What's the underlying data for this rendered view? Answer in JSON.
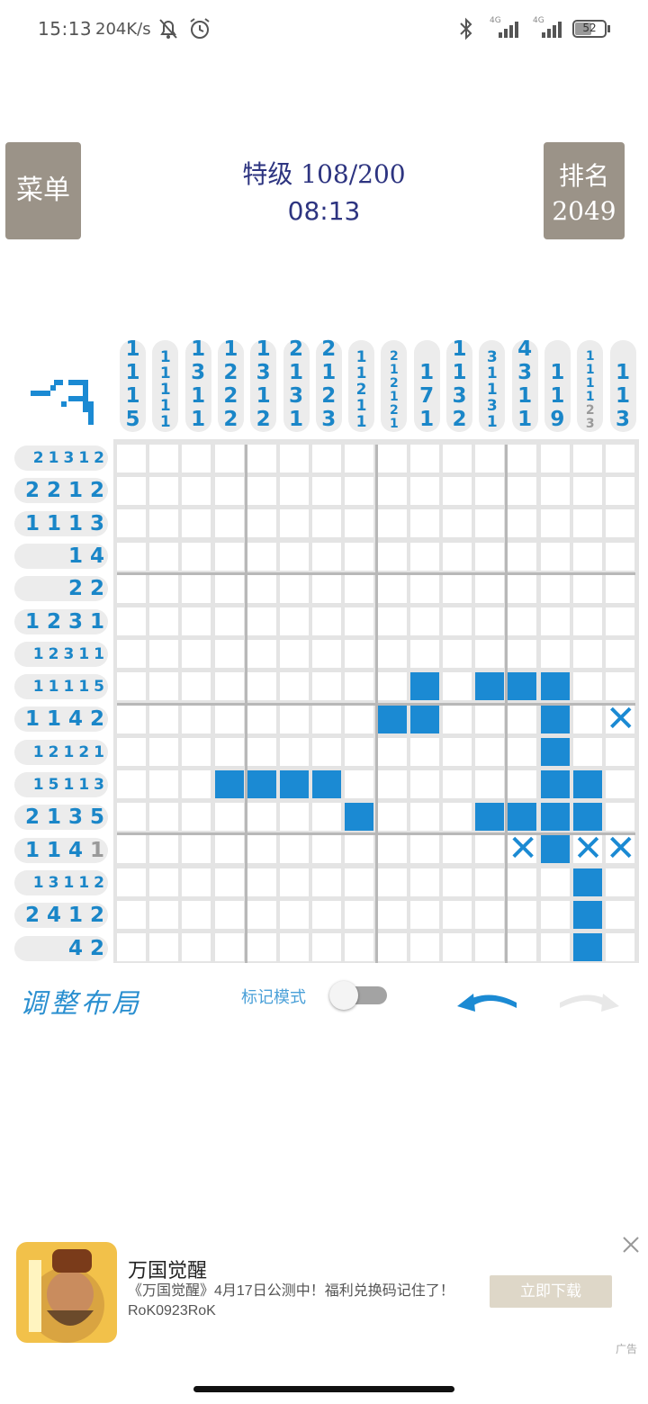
{
  "status_bar": {
    "time": "15:13",
    "speed": "204K/s",
    "battery": "52",
    "network_1": "4G",
    "network_2": "4G"
  },
  "header": {
    "menu_label": "菜单",
    "rank_label": "排名",
    "rank_value": "2049",
    "level_title": "特级 108/200",
    "timer": "08:13"
  },
  "puzzle": {
    "size": 16,
    "column_clues": [
      [
        {
          "v": "1"
        },
        {
          "v": "1"
        },
        {
          "v": "1"
        },
        {
          "v": "5"
        }
      ],
      [
        {
          "v": "1"
        },
        {
          "v": "1"
        },
        {
          "v": "1"
        },
        {
          "v": "1"
        },
        {
          "v": "1"
        }
      ],
      [
        {
          "v": "1"
        },
        {
          "v": "3"
        },
        {
          "v": "1"
        },
        {
          "v": "1"
        }
      ],
      [
        {
          "v": "1"
        },
        {
          "v": "2"
        },
        {
          "v": "2"
        },
        {
          "v": "2"
        }
      ],
      [
        {
          "v": "1"
        },
        {
          "v": "3"
        },
        {
          "v": "1"
        },
        {
          "v": "2"
        }
      ],
      [
        {
          "v": "2"
        },
        {
          "v": "1"
        },
        {
          "v": "3"
        },
        {
          "v": "1"
        }
      ],
      [
        {
          "v": "2"
        },
        {
          "v": "1"
        },
        {
          "v": "2"
        },
        {
          "v": "3"
        }
      ],
      [
        {
          "v": "1"
        },
        {
          "v": "1"
        },
        {
          "v": "2"
        },
        {
          "v": "1"
        },
        {
          "v": "1"
        }
      ],
      [
        {
          "v": "2"
        },
        {
          "v": "1"
        },
        {
          "v": "2"
        },
        {
          "v": "1"
        },
        {
          "v": "2"
        },
        {
          "v": "1"
        }
      ],
      [
        {
          "v": "1"
        },
        {
          "v": "7"
        },
        {
          "v": "1"
        }
      ],
      [
        {
          "v": "1"
        },
        {
          "v": "1"
        },
        {
          "v": "3"
        },
        {
          "v": "2"
        }
      ],
      [
        {
          "v": "3"
        },
        {
          "v": "1"
        },
        {
          "v": "1"
        },
        {
          "v": "3"
        },
        {
          "v": "1"
        }
      ],
      [
        {
          "v": "4"
        },
        {
          "v": "3"
        },
        {
          "v": "1"
        },
        {
          "v": "1"
        }
      ],
      [
        {
          "v": "1"
        },
        {
          "v": "1"
        },
        {
          "v": "9"
        }
      ],
      [
        {
          "v": "1"
        },
        {
          "v": "1"
        },
        {
          "v": "1"
        },
        {
          "v": "1"
        },
        {
          "v": "2",
          "done": true
        },
        {
          "v": "3",
          "done": true
        }
      ],
      [
        {
          "v": "1"
        },
        {
          "v": "1"
        },
        {
          "v": "3"
        }
      ]
    ],
    "row_clues": [
      [
        {
          "v": "2"
        },
        {
          "v": "1"
        },
        {
          "v": "3"
        },
        {
          "v": "1"
        },
        {
          "v": "2"
        }
      ],
      [
        {
          "v": "2"
        },
        {
          "v": "2"
        },
        {
          "v": "1"
        },
        {
          "v": "2"
        }
      ],
      [
        {
          "v": "1"
        },
        {
          "v": "1"
        },
        {
          "v": "1"
        },
        {
          "v": "3"
        }
      ],
      [
        {
          "v": "1"
        },
        {
          "v": "4"
        }
      ],
      [
        {
          "v": "2"
        },
        {
          "v": "2"
        }
      ],
      [
        {
          "v": "1"
        },
        {
          "v": "2"
        },
        {
          "v": "3"
        },
        {
          "v": "1"
        }
      ],
      [
        {
          "v": "1"
        },
        {
          "v": "2"
        },
        {
          "v": "3"
        },
        {
          "v": "1"
        },
        {
          "v": "1"
        }
      ],
      [
        {
          "v": "1"
        },
        {
          "v": "1"
        },
        {
          "v": "1"
        },
        {
          "v": "1"
        },
        {
          "v": "5"
        }
      ],
      [
        {
          "v": "1"
        },
        {
          "v": "1"
        },
        {
          "v": "4"
        },
        {
          "v": "2"
        }
      ],
      [
        {
          "v": "1"
        },
        {
          "v": "2"
        },
        {
          "v": "1"
        },
        {
          "v": "2"
        },
        {
          "v": "1"
        }
      ],
      [
        {
          "v": "1"
        },
        {
          "v": "5"
        },
        {
          "v": "1"
        },
        {
          "v": "1"
        },
        {
          "v": "3"
        }
      ],
      [
        {
          "v": "2"
        },
        {
          "v": "1"
        },
        {
          "v": "3"
        },
        {
          "v": "5"
        }
      ],
      [
        {
          "v": "1"
        },
        {
          "v": "1"
        },
        {
          "v": "4"
        },
        {
          "v": "1",
          "done": true
        }
      ],
      [
        {
          "v": "1"
        },
        {
          "v": "3"
        },
        {
          "v": "1"
        },
        {
          "v": "1"
        },
        {
          "v": "2"
        }
      ],
      [
        {
          "v": "2"
        },
        {
          "v": "4"
        },
        {
          "v": "1"
        },
        {
          "v": "2"
        }
      ],
      [
        {
          "v": "4"
        },
        {
          "v": "2"
        }
      ]
    ],
    "filled_cells": [
      [
        7,
        9
      ],
      [
        7,
        11
      ],
      [
        7,
        12
      ],
      [
        7,
        13
      ],
      [
        8,
        8
      ],
      [
        8,
        9
      ],
      [
        8,
        13
      ],
      [
        9,
        13
      ],
      [
        10,
        3
      ],
      [
        10,
        4
      ],
      [
        10,
        5
      ],
      [
        10,
        6
      ],
      [
        10,
        13
      ],
      [
        10,
        14
      ],
      [
        11,
        7
      ],
      [
        11,
        11
      ],
      [
        11,
        12
      ],
      [
        11,
        13
      ],
      [
        11,
        14
      ],
      [
        12,
        13
      ],
      [
        13,
        14
      ],
      [
        14,
        14
      ],
      [
        15,
        14
      ]
    ],
    "crossed_cells": [
      [
        8,
        15
      ],
      [
        12,
        12
      ],
      [
        12,
        14
      ],
      [
        12,
        15
      ]
    ],
    "fill_color": "#1b8ad3"
  },
  "controls": {
    "adjust_layout": "调整布局",
    "mark_mode": "标记模式",
    "mark_mode_on": false
  },
  "ad": {
    "title": "万国觉醒",
    "description": "《万国觉醒》4月17日公测中！福利兑换码记住了！RoK0923RoK",
    "download_label": "立即下载",
    "ad_label": "广告"
  }
}
